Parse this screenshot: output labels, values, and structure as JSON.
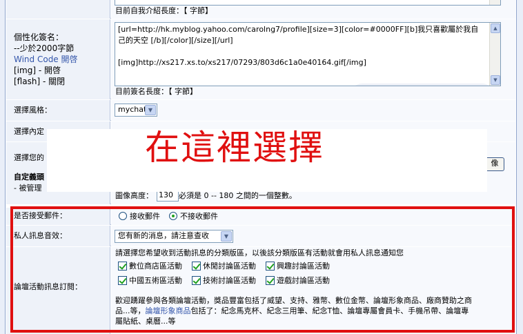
{
  "intro_length": {
    "label": "目前自我介紹長度：【 字節】"
  },
  "signature": {
    "label_title": "個性化簽名：",
    "label_limit": "--少於2000字節",
    "label_windcode": "Wind Code 開啓",
    "label_img": "[img] - 開啓",
    "label_flash": "[flash] - 關閉",
    "text_line1": "[url=http://hk.myblog.yahoo.com/carolng7/profile][size=3][color=#0000FF][b]我只喜歡屬於我自",
    "text_line2": "己的天空 [/b][/color][/size][/url]",
    "text_line3": "[img]http://xs217.xs.to/xs217/07293/803d6c1a0e40164.gif[/img]",
    "length_label": "目前簽名長度：【 字節】"
  },
  "style": {
    "label": "選擇風格：",
    "value": "mychat"
  },
  "partial_row": {
    "label": "選擇內定"
  },
  "avatar": {
    "label_select": "選擇您的",
    "label_custom": "自定義頭",
    "label_admin": "- 被管理",
    "button_label": "像",
    "height_label": "圖像高度：",
    "height_value": "130",
    "height_hint": "必須是 0 -- 180 之間的一個整數。"
  },
  "overlay": {
    "text": "在這裡選擇"
  },
  "email": {
    "label": "是否接受郵件：",
    "option_yes": "接收郵件",
    "option_no": "不接收郵件",
    "selected": "no"
  },
  "pm_sound": {
    "label": "私人訊息音效：",
    "value": "您有新的消息，請注意查收"
  },
  "forum_sub": {
    "label": "論壇活動訊息訂閱：",
    "intro": "請選擇您希望收到活動訊息的分類版區，以後該分類版區有活動就會用私人訊息通知您",
    "checkboxes": [
      "數位商店區活動",
      "休閒討論區活動",
      "興趣討論區活動",
      "中國五術區活動",
      "技術討論區活動",
      "遊戲討論區活動"
    ],
    "desc_line1": "歡迎踴躍參與各類論壇活動，獎品豐富包括了威望、支持、雅幣、數位金幣、論壇形象商品、廠商贊助之商",
    "desc_line2_pre": "品...等，",
    "desc_link": "論壇形象商品",
    "desc_line2_post": "包括了：紀念馬克杯、紀念三用筆、紀念T恤、論壇專屬會員卡、手機吊帶、論壇專",
    "desc_line3": "屬貼紙、桌曆...等"
  }
}
